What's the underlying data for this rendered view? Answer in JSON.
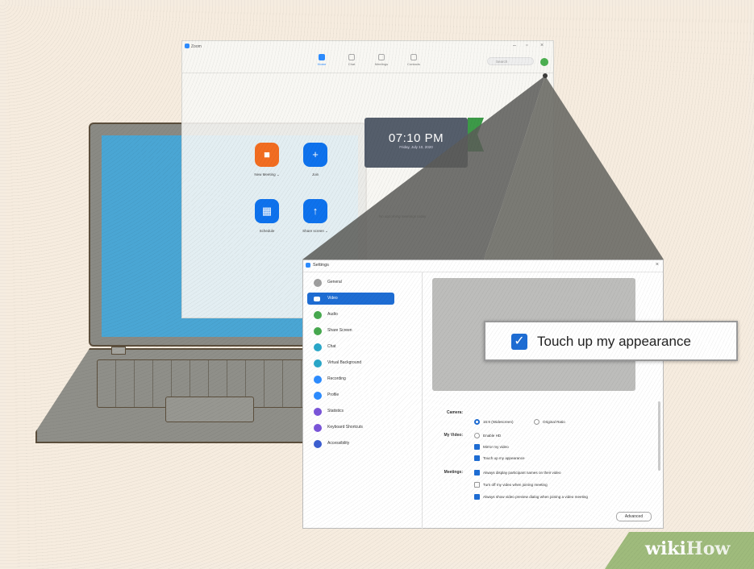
{
  "zoom_window": {
    "title": "Zoom",
    "nav": [
      {
        "label": "Home",
        "icon": "home-icon",
        "active": true
      },
      {
        "label": "Chat",
        "icon": "chat-icon",
        "active": false
      },
      {
        "label": "Meetings",
        "icon": "calendar-icon",
        "active": false
      },
      {
        "label": "Contacts",
        "icon": "contacts-icon",
        "active": false
      }
    ],
    "search_placeholder": "Search",
    "tiles": [
      {
        "label": "New Meeting ⌄",
        "icon": "video-camera-icon",
        "color": "#f26d21"
      },
      {
        "label": "Join",
        "icon": "plus-icon",
        "color": "#0e72ed"
      },
      {
        "label": "Schedule",
        "icon": "calendar-icon",
        "color": "#0e72ed"
      },
      {
        "label": "Share screen ⌄",
        "icon": "share-up-arrow-icon",
        "color": "#0e72ed"
      }
    ],
    "clock_time": "07:10 PM",
    "clock_date": "Friday, July 10, 2020",
    "no_meetings": "No upcoming meetings today"
  },
  "settings": {
    "title": "Settings",
    "sidebar": [
      {
        "label": "General",
        "color": "#9e9e9e"
      },
      {
        "label": "Video",
        "color": "#ffffff",
        "active": true
      },
      {
        "label": "Audio",
        "color": "#47a94f"
      },
      {
        "label": "Share Screen",
        "color": "#47a94f"
      },
      {
        "label": "Chat",
        "color": "#2aa7c9"
      },
      {
        "label": "Virtual Background",
        "color": "#2aa7c9"
      },
      {
        "label": "Recording",
        "color": "#2d8cff"
      },
      {
        "label": "Profile",
        "color": "#2d8cff"
      },
      {
        "label": "Statistics",
        "color": "#7a55d9"
      },
      {
        "label": "Keyboard Shortcuts",
        "color": "#7a55d9"
      },
      {
        "label": "Accessibility",
        "color": "#3c5fd1"
      }
    ],
    "camera_label": "Camera:",
    "camera_options": [
      "16:9 (Widescreen)",
      "Original Ratio"
    ],
    "my_video_label": "My Video:",
    "my_video_options": [
      {
        "label": "Enable HD",
        "checked": false
      },
      {
        "label": "Mirror my video",
        "checked": true
      },
      {
        "label": "Touch up my appearance",
        "checked": true
      }
    ],
    "meetings_label": "Meetings:",
    "meetings_options": [
      {
        "label": "Always display participant names on their video",
        "checked": true
      },
      {
        "label": "Turn off my video when joining meeting",
        "checked": false
      },
      {
        "label": "Always show video preview dialog when joining a video meeting",
        "checked": true
      }
    ],
    "advanced_button": "Advanced"
  },
  "callout_text": "Touch up my appearance",
  "watermark": {
    "part1": "wiki",
    "part2": "How"
  }
}
